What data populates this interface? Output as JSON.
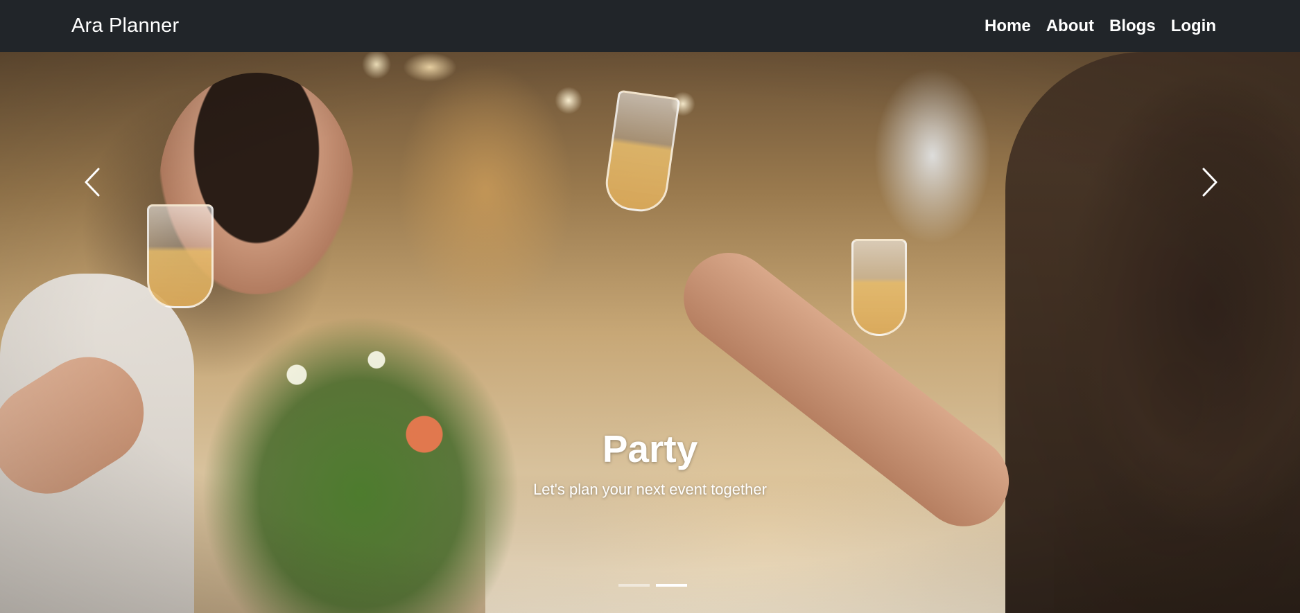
{
  "navbar": {
    "brand": "Ara Planner",
    "links": [
      {
        "label": "Home"
      },
      {
        "label": "About"
      },
      {
        "label": "Blogs"
      },
      {
        "label": "Login"
      }
    ]
  },
  "carousel": {
    "active_slide": 2,
    "slide_count": 2,
    "caption": {
      "title": "Party",
      "text": "Let's plan your next event together"
    },
    "prev_icon": "chevron-left-icon",
    "next_icon": "chevron-right-icon",
    "image": "party-toast-photo"
  },
  "colors": {
    "navbar_bg": "#212529",
    "text": "#ffffff"
  }
}
